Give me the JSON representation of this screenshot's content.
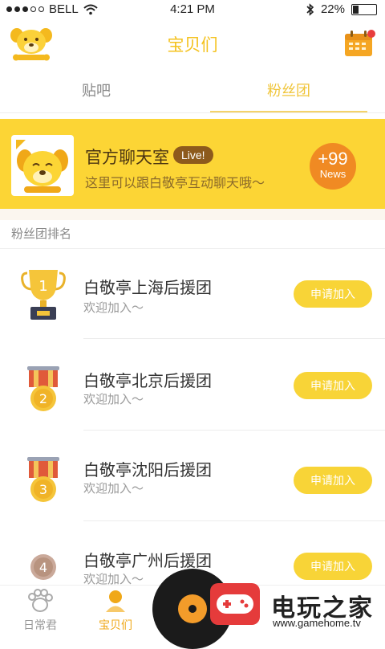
{
  "status_bar": {
    "carrier": "BELL",
    "time": "4:21 PM",
    "battery": "22%",
    "battery_level": 0.22,
    "signal_icon": "signal-dots-icon",
    "wifi_icon": "wifi-icon",
    "bluetooth_icon": "bluetooth-icon"
  },
  "header": {
    "title": "宝贝们",
    "left_icon": "dog-logo-icon",
    "right_icon": "calendar-icon"
  },
  "tabs": [
    {
      "label": "贴吧",
      "active": false
    },
    {
      "label": "粉丝团",
      "active": true
    }
  ],
  "chat_room": {
    "title": "官方聊天室",
    "live_label": "Live!",
    "subtitle": "这里可以跟白敬亭互动聊天哦～",
    "news_count": "+99",
    "news_label": "News"
  },
  "ranking": {
    "section_title": "粉丝团排名",
    "join_label": "申请加入",
    "items": [
      {
        "rank": "1",
        "name": "白敬亭上海后援团",
        "subtitle": "欢迎加入～",
        "icon": "trophy-icon"
      },
      {
        "rank": "2",
        "name": "白敬亭北京后援团",
        "subtitle": "欢迎加入～",
        "icon": "medal-icon"
      },
      {
        "rank": "3",
        "name": "白敬亭沈阳后援团",
        "subtitle": "欢迎加入～",
        "icon": "medal-icon"
      },
      {
        "rank": "4",
        "name": "白敬亭广州后援团",
        "subtitle": "欢迎加入～",
        "icon": "rank-circle-icon"
      }
    ]
  },
  "bottom_nav": {
    "items": [
      {
        "label": "日常君",
        "icon": "paw-icon",
        "active": false
      },
      {
        "label": "宝贝们",
        "icon": "person-icon",
        "active": true
      }
    ]
  },
  "watermark": {
    "title": "电玩之家",
    "url": "www.gamehome.tv"
  },
  "colors": {
    "accent": "#f4c21e",
    "banner": "#fcd535",
    "button": "#f8d437",
    "news": "#f08a23",
    "live_badge": "#8d5a1c"
  }
}
